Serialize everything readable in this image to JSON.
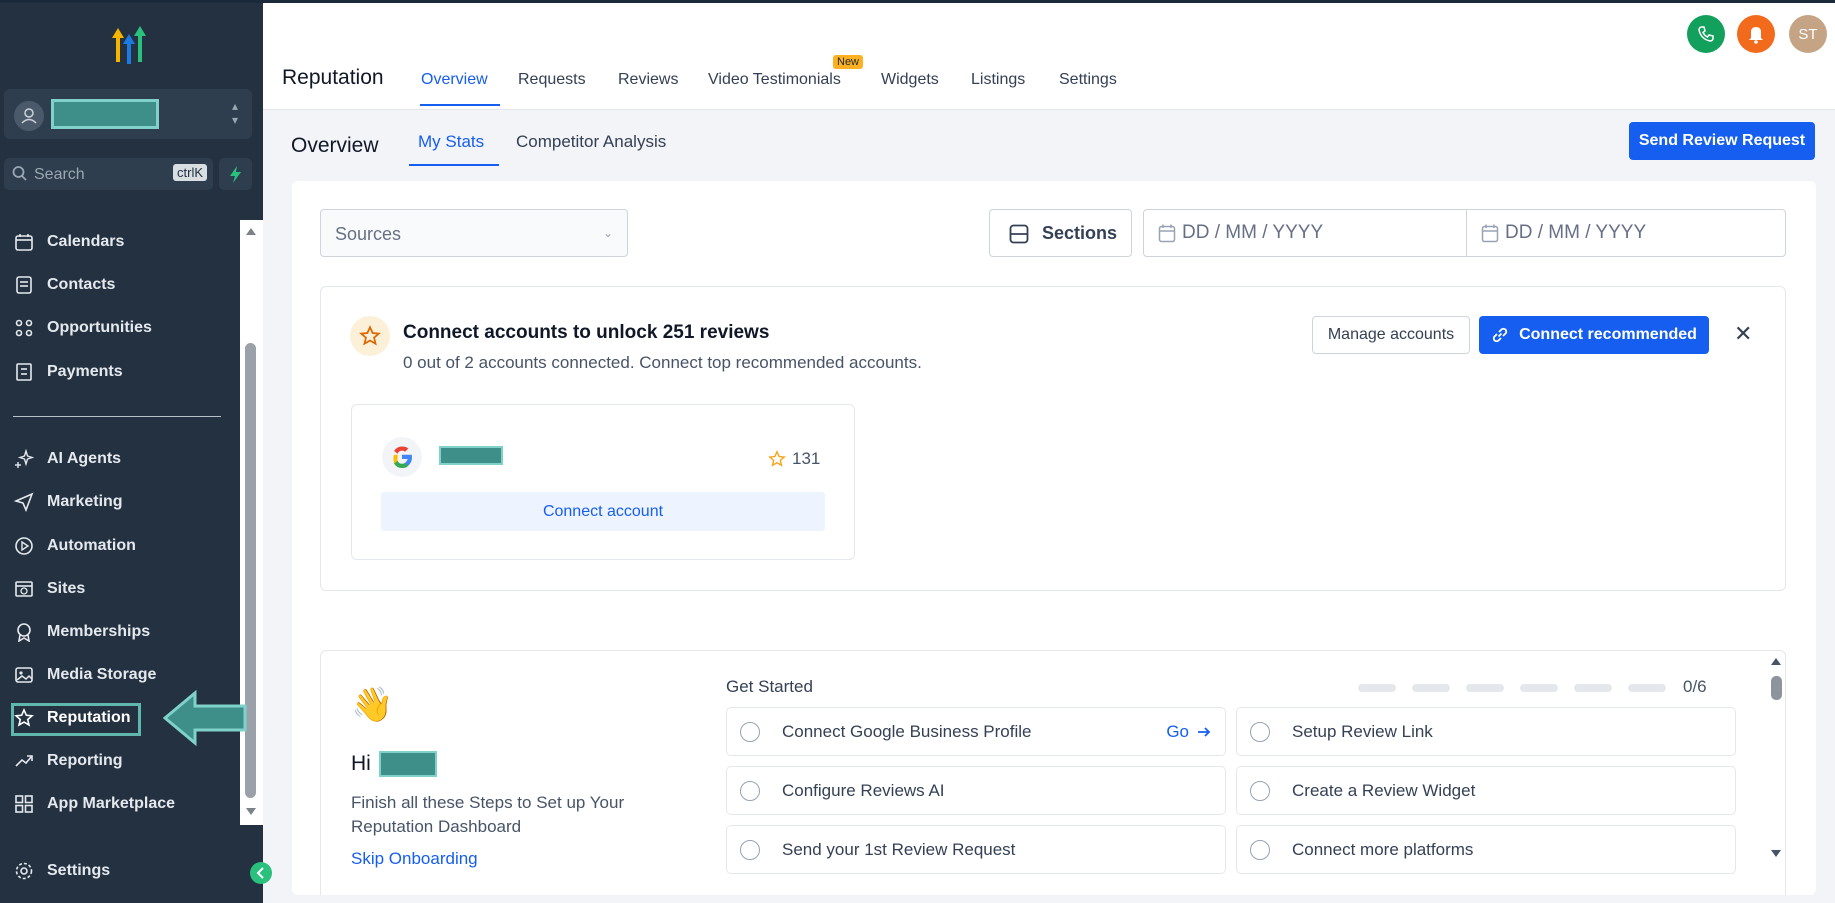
{
  "sidebar": {
    "search_placeholder": "Search",
    "search_shortcut": "ctrlK",
    "items": [
      {
        "label": "Calendars",
        "icon": "calendar-icon"
      },
      {
        "label": "Contacts",
        "icon": "contacts-icon"
      },
      {
        "label": "Opportunities",
        "icon": "opportunities-icon"
      },
      {
        "label": "Payments",
        "icon": "payments-icon"
      },
      {
        "label": "AI Agents",
        "icon": "sparkles-icon"
      },
      {
        "label": "Marketing",
        "icon": "send-icon"
      },
      {
        "label": "Automation",
        "icon": "automation-icon"
      },
      {
        "label": "Sites",
        "icon": "globe-icon"
      },
      {
        "label": "Memberships",
        "icon": "badge-icon"
      },
      {
        "label": "Media Storage",
        "icon": "image-icon"
      },
      {
        "label": "Reputation",
        "icon": "star-icon",
        "active": true
      },
      {
        "label": "Reporting",
        "icon": "trend-icon"
      },
      {
        "label": "App Marketplace",
        "icon": "grid-icon"
      }
    ],
    "settings_label": "Settings"
  },
  "header": {
    "app_title": "Reputation",
    "tabs": [
      "Overview",
      "Requests",
      "Reviews",
      "Video Testimonials",
      "Widgets",
      "Listings",
      "Settings"
    ],
    "new_badge": "New",
    "user_initials": "ST"
  },
  "subheader": {
    "title": "Overview",
    "tabs": [
      "My Stats",
      "Competitor Analysis"
    ],
    "send_button": "Send Review Request"
  },
  "filters": {
    "sources_placeholder": "Sources",
    "sections_label": "Sections",
    "date_start_placeholder": "DD / MM / YYYY",
    "date_end_placeholder": "DD / MM / YYYY"
  },
  "connect": {
    "title": "Connect accounts to unlock 251 reviews",
    "subtitle": "0 out of 2 accounts connected. Connect top recommended accounts.",
    "manage_button": "Manage accounts",
    "recommend_button": "Connect recommended",
    "google": {
      "rating_count": "131",
      "connect_button": "Connect account"
    }
  },
  "onboarding": {
    "greeting": "Hi",
    "description": "Finish all these Steps to Set up Your Reputation Dashboard",
    "skip_label": "Skip Onboarding",
    "get_started": "Get Started",
    "progress_text": "0/6",
    "go_label": "Go",
    "tasks": [
      "Connect Google Business Profile",
      "Setup Review Link",
      "Configure Reviews AI",
      "Create a Review Widget",
      "Send your 1st Review Request",
      "Connect more platforms"
    ]
  },
  "colors": {
    "sidebar_bg": "#233140",
    "primary": "#155eef",
    "phone": "#12a05c",
    "bell": "#f26b1d",
    "highlight": "#5fb7ae"
  }
}
